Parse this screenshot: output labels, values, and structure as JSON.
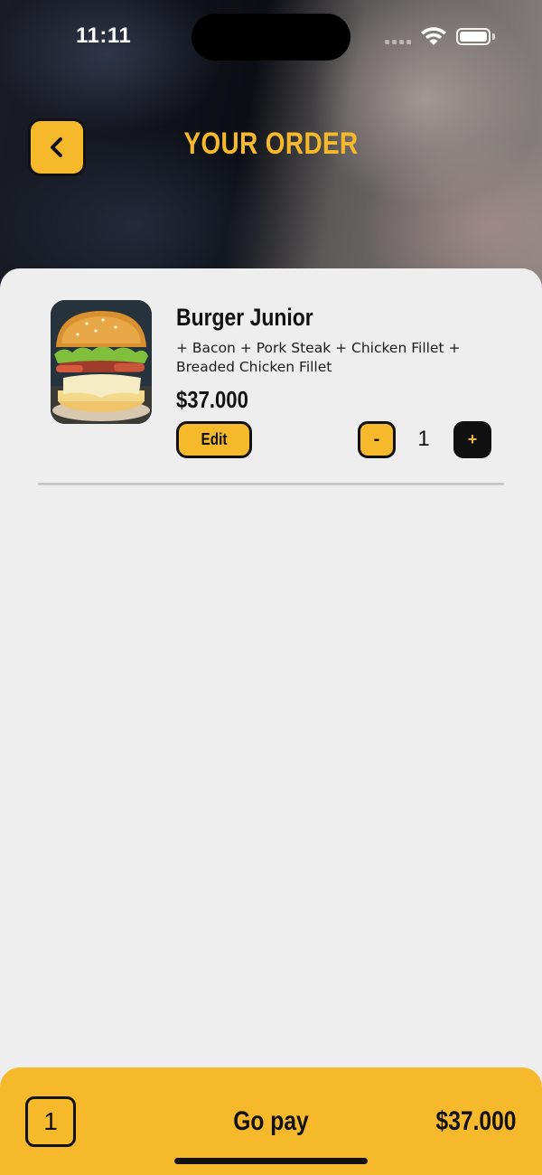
{
  "status_bar": {
    "time": "11:11",
    "wifi_icon": "wifi-icon",
    "battery_icon": "battery-full-icon"
  },
  "header": {
    "title": "YOUR ORDER",
    "back_icon": "chevron-left-icon"
  },
  "order_items": [
    {
      "name": "Burger Junior",
      "extras": "+ Bacon + Pork Steak + Chicken Fillet + Breaded Chicken Fillet",
      "price": "$37.000",
      "edit_label": "Edit",
      "minus_label": "-",
      "quantity": "1",
      "plus_label": "+",
      "image_icon": "burger-photo"
    }
  ],
  "pay_bar": {
    "item_count": "1",
    "action_label": "Go pay",
    "total": "$37.000"
  },
  "colors": {
    "accent": "#f6b92b",
    "dark": "#111111",
    "background": "#eeeeee"
  }
}
